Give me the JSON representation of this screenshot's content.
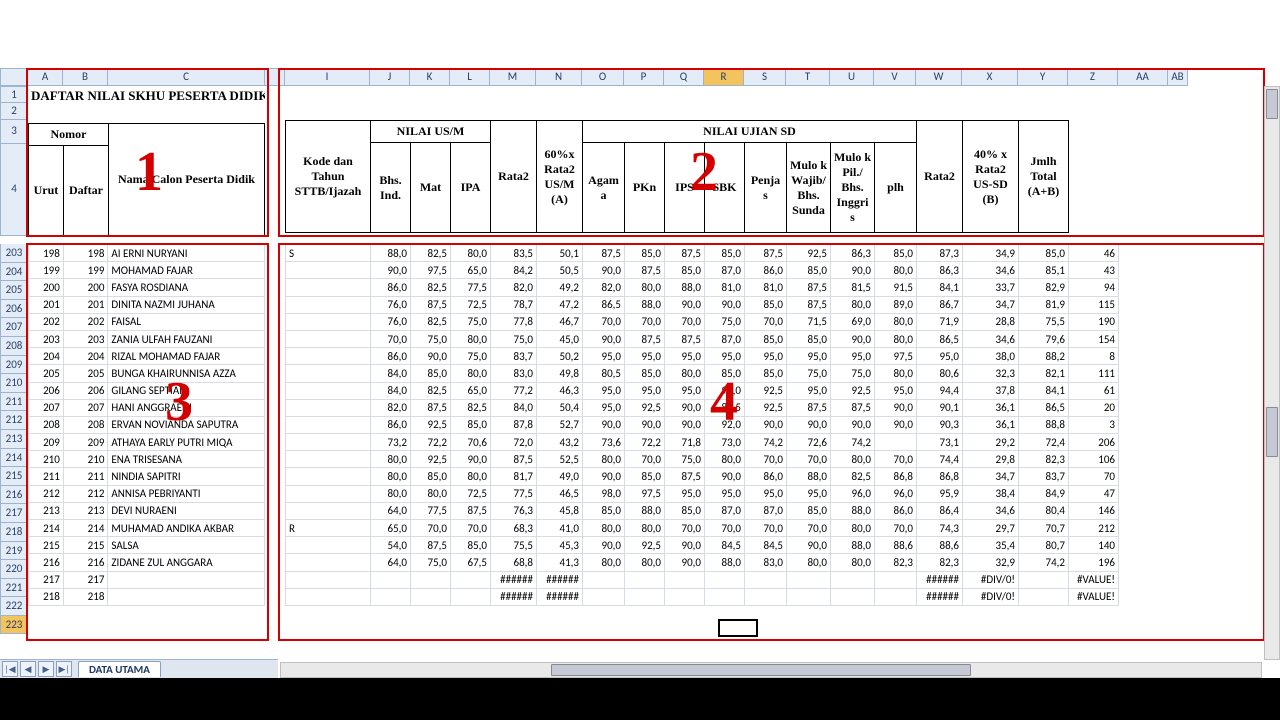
{
  "title_row": "DAFTAR NILAI SKHU PESERTA DIDIK",
  "tabs": {
    "sheet": "DATA UTAMA"
  },
  "nav": {
    "first": "|◀",
    "prev": "◀",
    "next": "▶",
    "last": "▶|"
  },
  "columns": [
    "A",
    "B",
    "C",
    "I",
    "J",
    "K",
    "L",
    "M",
    "N",
    "O",
    "P",
    "Q",
    "R",
    "S",
    "T",
    "U",
    "V",
    "W",
    "X",
    "Y",
    "Z",
    "AA",
    "AB"
  ],
  "active_col": "R",
  "row_header_top": [
    "1",
    "2",
    "3",
    "4"
  ],
  "row_header_data": [
    "203",
    "204",
    "205",
    "206",
    "207",
    "208",
    "209",
    "210",
    "211",
    "212",
    "213",
    "214",
    "215",
    "216",
    "217",
    "218",
    "219",
    "220",
    "221",
    "222",
    "223"
  ],
  "active_row": "223",
  "labels": {
    "nomor": "Nomor",
    "urut": "Urut",
    "daftar": "Daftar",
    "nama": "Nama Calon Peserta Didik",
    "kode": "Kode dan Tahun STTB/Ijazah",
    "nilai_usm": "NILAI US/M",
    "bhs": "Bhs. Ind.",
    "mat": "Mat",
    "ipa": "IPA",
    "rata2": "Rata2",
    "p60": "60%x Rata2 US/M (A)",
    "nilai_sd": "NILAI UJIAN SD",
    "agama": "Agam a",
    "pkn": "PKn",
    "ips": "IPS",
    "sbk": "SBK",
    "penjas": "Penja s",
    "mulok1": "Mulo k Wajib/ Bhs. Sunda",
    "mulok2": "Mulo k Pil./ Bhs. Inggri s",
    "plh": "plh",
    "p40": "40% x Rata2 US-SD (B)",
    "jml": "Jmlh Total (A+B)"
  },
  "overlay_numbers": {
    "n1": "1",
    "n2": "2",
    "n3": "3",
    "n4": "4"
  },
  "rows": [
    {
      "u": 198,
      "d": 198,
      "n": "AI ERNI NURYANI",
      "ext": "S",
      "j": "88,0",
      "k": "82,5",
      "l": "80,0",
      "m": "83,5",
      "nn": "50,1",
      "o": "87,5",
      "p": "85,0",
      "q": "87,5",
      "r": "85,0",
      "s": "87,5",
      "t": "92,5",
      "uu": "86,3",
      "v": "85,0",
      "w": "87,3",
      "x": "34,9",
      "y": "85,0",
      "z": "46"
    },
    {
      "u": 199,
      "d": 199,
      "n": "MOHAMAD FAJAR",
      "j": "90,0",
      "k": "97,5",
      "l": "65,0",
      "m": "84,2",
      "nn": "50,5",
      "o": "90,0",
      "p": "87,5",
      "q": "85,0",
      "r": "87,0",
      "s": "86,0",
      "t": "85,0",
      "uu": "90,0",
      "v": "80,0",
      "w": "86,3",
      "x": "34,6",
      "y": "85,1",
      "z": "43"
    },
    {
      "u": 200,
      "d": 200,
      "n": "FASYA ROSDIANA",
      "j": "86,0",
      "k": "82,5",
      "l": "77,5",
      "m": "82,0",
      "nn": "49,2",
      "o": "82,0",
      "p": "80,0",
      "q": "88,0",
      "r": "81,0",
      "s": "81,0",
      "t": "87,5",
      "uu": "81,5",
      "v": "91,5",
      "w": "84,1",
      "x": "33,7",
      "y": "82,9",
      "z": "94"
    },
    {
      "u": 201,
      "d": 201,
      "n": "DINITA NAZMI JUHANA",
      "j": "76,0",
      "k": "87,5",
      "l": "72,5",
      "m": "78,7",
      "nn": "47,2",
      "o": "86,5",
      "p": "88,0",
      "q": "90,0",
      "r": "90,0",
      "s": "85,0",
      "t": "87,5",
      "uu": "80,0",
      "v": "89,0",
      "w": "86,7",
      "x": "34,7",
      "y": "81,9",
      "z": "115"
    },
    {
      "u": 202,
      "d": 202,
      "n": "FAISAL",
      "j": "76,0",
      "k": "82,5",
      "l": "75,0",
      "m": "77,8",
      "nn": "46,7",
      "o": "70,0",
      "p": "70,0",
      "q": "70,0",
      "r": "75,0",
      "s": "70,0",
      "t": "71,5",
      "uu": "69,0",
      "v": "80,0",
      "w": "71,9",
      "x": "28,8",
      "y": "75,5",
      "z": "190"
    },
    {
      "u": 203,
      "d": 203,
      "n": "ZANIA ULFAH FAUZANI",
      "j": "70,0",
      "k": "75,0",
      "l": "80,0",
      "m": "75,0",
      "nn": "45,0",
      "o": "90,0",
      "p": "87,5",
      "q": "87,5",
      "r": "87,0",
      "s": "85,0",
      "t": "85,0",
      "uu": "90,0",
      "v": "80,0",
      "w": "86,5",
      "x": "34,6",
      "y": "79,6",
      "z": "154"
    },
    {
      "u": 204,
      "d": 204,
      "n": "RIZAL MOHAMAD FAJAR",
      "j": "86,0",
      "k": "90,0",
      "l": "75,0",
      "m": "83,7",
      "nn": "50,2",
      "o": "95,0",
      "p": "95,0",
      "q": "95,0",
      "r": "95,0",
      "s": "95,0",
      "t": "95,0",
      "uu": "95,0",
      "v": "97,5",
      "w": "95,0",
      "x": "38,0",
      "y": "88,2",
      "z": "8"
    },
    {
      "u": 205,
      "d": 205,
      "n": "BUNGA KHAIRUNNISA AZZA",
      "j": "84,0",
      "k": "85,0",
      "l": "80,0",
      "m": "83,0",
      "nn": "49,8",
      "o": "80,5",
      "p": "85,0",
      "q": "80,0",
      "r": "85,0",
      "s": "85,0",
      "t": "75,0",
      "uu": "75,0",
      "v": "80,0",
      "w": "80,6",
      "x": "32,3",
      "y": "82,1",
      "z": "111"
    },
    {
      "u": 206,
      "d": 206,
      "n": "GILANG SEPTIAN",
      "j": "84,0",
      "k": "82,5",
      "l": "65,0",
      "m": "77,2",
      "nn": "46,3",
      "o": "95,0",
      "p": "95,0",
      "q": "95,0",
      "r": "95,0",
      "s": "92,5",
      "t": "95,0",
      "uu": "92,5",
      "v": "95,0",
      "w": "94,4",
      "x": "37,8",
      "y": "84,1",
      "z": "61"
    },
    {
      "u": 207,
      "d": 207,
      "n": "HANI ANGGRAENI",
      "j": "82,0",
      "k": "87,5",
      "l": "82,5",
      "m": "84,0",
      "nn": "50,4",
      "o": "95,0",
      "p": "92,5",
      "q": "90,0",
      "r": "88,5",
      "s": "92,5",
      "t": "87,5",
      "uu": "87,5",
      "v": "90,0",
      "w": "90,1",
      "x": "36,1",
      "y": "86,5",
      "z": "20"
    },
    {
      "u": 208,
      "d": 208,
      "n": "ERVAN NOVIANDA SAPUTRA",
      "j": "86,0",
      "k": "92,5",
      "l": "85,0",
      "m": "87,8",
      "nn": "52,7",
      "o": "90,0",
      "p": "90,0",
      "q": "90,0",
      "r": "92,0",
      "s": "90,0",
      "t": "90,0",
      "uu": "90,0",
      "v": "90,0",
      "w": "90,3",
      "x": "36,1",
      "y": "88,8",
      "z": "3"
    },
    {
      "u": 209,
      "d": 209,
      "n": "ATHAYA EARLY PUTRI MIQA",
      "j": "73,2",
      "k": "72,2",
      "l": "70,6",
      "m": "72,0",
      "nn": "43,2",
      "o": "73,6",
      "p": "72,2",
      "q": "71,8",
      "r": "73,0",
      "s": "74,2",
      "t": "72,6",
      "uu": "74,2",
      "v": "",
      "w": "73,1",
      "x": "29,2",
      "y": "72,4",
      "z": "206"
    },
    {
      "u": 210,
      "d": 210,
      "n": "ENA TRISESANA",
      "j": "80,0",
      "k": "92,5",
      "l": "90,0",
      "m": "87,5",
      "nn": "52,5",
      "o": "80,0",
      "p": "70,0",
      "q": "75,0",
      "r": "80,0",
      "s": "70,0",
      "t": "70,0",
      "uu": "80,0",
      "v": "70,0",
      "w": "74,4",
      "x": "29,8",
      "y": "82,3",
      "z": "106"
    },
    {
      "u": 211,
      "d": 211,
      "n": "NINDIA SAPITRI",
      "j": "80,0",
      "k": "85,0",
      "l": "80,0",
      "m": "81,7",
      "nn": "49,0",
      "o": "90,0",
      "p": "85,0",
      "q": "87,5",
      "r": "90,0",
      "s": "86,0",
      "t": "88,0",
      "uu": "82,5",
      "v": "86,8",
      "w": "86,8",
      "x": "34,7",
      "y": "83,7",
      "z": "70"
    },
    {
      "u": 212,
      "d": 212,
      "n": "ANNISA PEBRIYANTI",
      "j": "80,0",
      "k": "80,0",
      "l": "72,5",
      "m": "77,5",
      "nn": "46,5",
      "o": "98,0",
      "p": "97,5",
      "q": "95,0",
      "r": "95,0",
      "s": "95,0",
      "t": "95,0",
      "uu": "96,0",
      "v": "96,0",
      "w": "95,9",
      "x": "38,4",
      "y": "84,9",
      "z": "47"
    },
    {
      "u": 213,
      "d": 213,
      "n": "DEVI NURAENI",
      "j": "64,0",
      "k": "77,5",
      "l": "87,5",
      "m": "76,3",
      "nn": "45,8",
      "o": "85,0",
      "p": "88,0",
      "q": "85,0",
      "r": "87,0",
      "s": "87,0",
      "t": "85,0",
      "uu": "88,0",
      "v": "86,0",
      "w": "86,4",
      "x": "34,6",
      "y": "80,4",
      "z": "146"
    },
    {
      "u": 214,
      "d": 214,
      "n": "MUHAMAD ANDIKA AKBAR",
      "ext": "R",
      "j": "65,0",
      "k": "70,0",
      "l": "70,0",
      "m": "68,3",
      "nn": "41,0",
      "o": "80,0",
      "p": "80,0",
      "q": "70,0",
      "r": "70,0",
      "s": "70,0",
      "t": "70,0",
      "uu": "80,0",
      "v": "70,0",
      "w": "74,3",
      "x": "29,7",
      "y": "70,7",
      "z": "212"
    },
    {
      "u": 215,
      "d": 215,
      "n": "SALSA",
      "j": "54,0",
      "k": "87,5",
      "l": "85,0",
      "m": "75,5",
      "nn": "45,3",
      "o": "90,0",
      "p": "92,5",
      "q": "90,0",
      "r": "84,5",
      "s": "84,5",
      "t": "90,0",
      "uu": "88,0",
      "v": "88,6",
      "w": "88,6",
      "x": "35,4",
      "y": "80,7",
      "z": "140"
    },
    {
      "u": 216,
      "d": 216,
      "n": "ZIDANE ZUL ANGGARA",
      "j": "64,0",
      "k": "75,0",
      "l": "67,5",
      "m": "68,8",
      "nn": "41,3",
      "o": "80,0",
      "p": "80,0",
      "q": "90,0",
      "r": "88,0",
      "s": "83,0",
      "t": "80,0",
      "uu": "80,0",
      "v": "82,3",
      "w": "82,3",
      "x": "32,9",
      "y": "74,2",
      "z": "196"
    },
    {
      "u": 217,
      "d": 217,
      "n": "",
      "m": "######",
      "nn": "######",
      "w": "######",
      "x": "#DIV/0!",
      "z": "#VALUE!"
    },
    {
      "u": 218,
      "d": 218,
      "n": "",
      "m": "######",
      "nn": "######",
      "w": "######",
      "x": "#DIV/0!",
      "z": "#VALUE!"
    }
  ]
}
